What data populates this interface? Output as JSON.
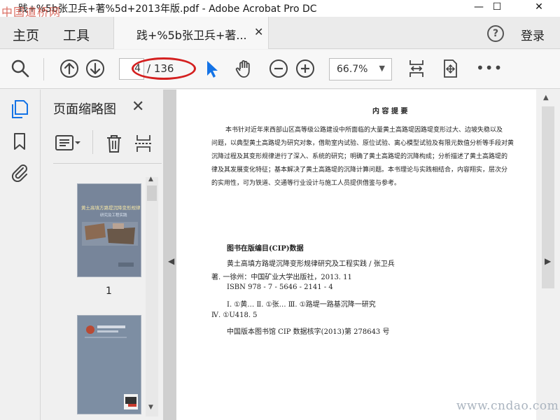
{
  "window": {
    "title": "践+%5b张卫兵+著%5d+2013年版.pdf - Adobe Acrobat Pro DC",
    "watermark_top": "中国道桥网",
    "controls": {
      "minimize": "—",
      "maximize": "☐",
      "close": "✕"
    }
  },
  "tabs": {
    "home": "主页",
    "tools": "工具",
    "document": "践+%5b张卫兵+著...",
    "document_close": "✕",
    "help": "?",
    "login": "登录"
  },
  "toolbar": {
    "current_page": "4",
    "page_total": "/ 136",
    "zoom": "66.7%",
    "zoom_caret": "▼",
    "more": "•••",
    "icons": [
      "search-icon",
      "prev-page-icon",
      "next-page-icon",
      "select-cursor-icon",
      "hand-icon",
      "zoom-out-icon",
      "zoom-in-icon",
      "scroll-mode-icon",
      "fit-page-icon",
      "more-icon"
    ],
    "highlight_color": "#d42020"
  },
  "rail": {
    "icons": [
      "page-thumbnails-icon",
      "bookmark-icon",
      "attachment-icon"
    ],
    "active_color": "#1473e6"
  },
  "thumb_panel": {
    "title": "页面缩略图",
    "close": "✕",
    "thumb1_label": "1",
    "thumb1_title": "黄土高填方路堤沉降变形规律",
    "thumb1_subtitle": "研究及工程实践"
  },
  "document": {
    "heading": "内 容 提 要",
    "summary_lines": [
      "本书针对近年来西部山区高等级公路建设中所面临的大量黄土高路堤因路堤变形过大、边坡失稳以及",
      "问题，以典型黄土高路堤为研究对象，借助室内试验、原位试验、离心模型试验及有限元数值分析等手段对黄",
      "沉降过程及其变形规律进行了深入、系统的研究；明确了黄土高路堤的沉降构成；分析描述了黄土高路堤的",
      "律及其发展变化特征；基本解决了黄土高路堤的沉降计算问题。本书理论与实践相结合，内容翔实，层次分",
      "的实用性，可为铁道、交通等行业设计与施工人员提供借鉴与参考。"
    ],
    "cip_heading": "图书在版编目(CIP)数据",
    "cip_lines": [
      "黄土高填方路堤沉降变形规律研究及工程实践 / 张卫兵",
      "著. 一徐州：中国矿业大学出版社，2013. 11",
      "ISBN 978 - 7 - 5646 - 2141 - 4",
      "Ⅰ. ①黄…  Ⅱ. ①张…  Ⅲ. ①路堤一路基沉降一研究",
      "Ⅳ. ①U418. 5",
      "中国版本图书馆 CIP 数据核字(2013)第 278643 号"
    ],
    "watermark_bottom": "www.cndao.com"
  }
}
